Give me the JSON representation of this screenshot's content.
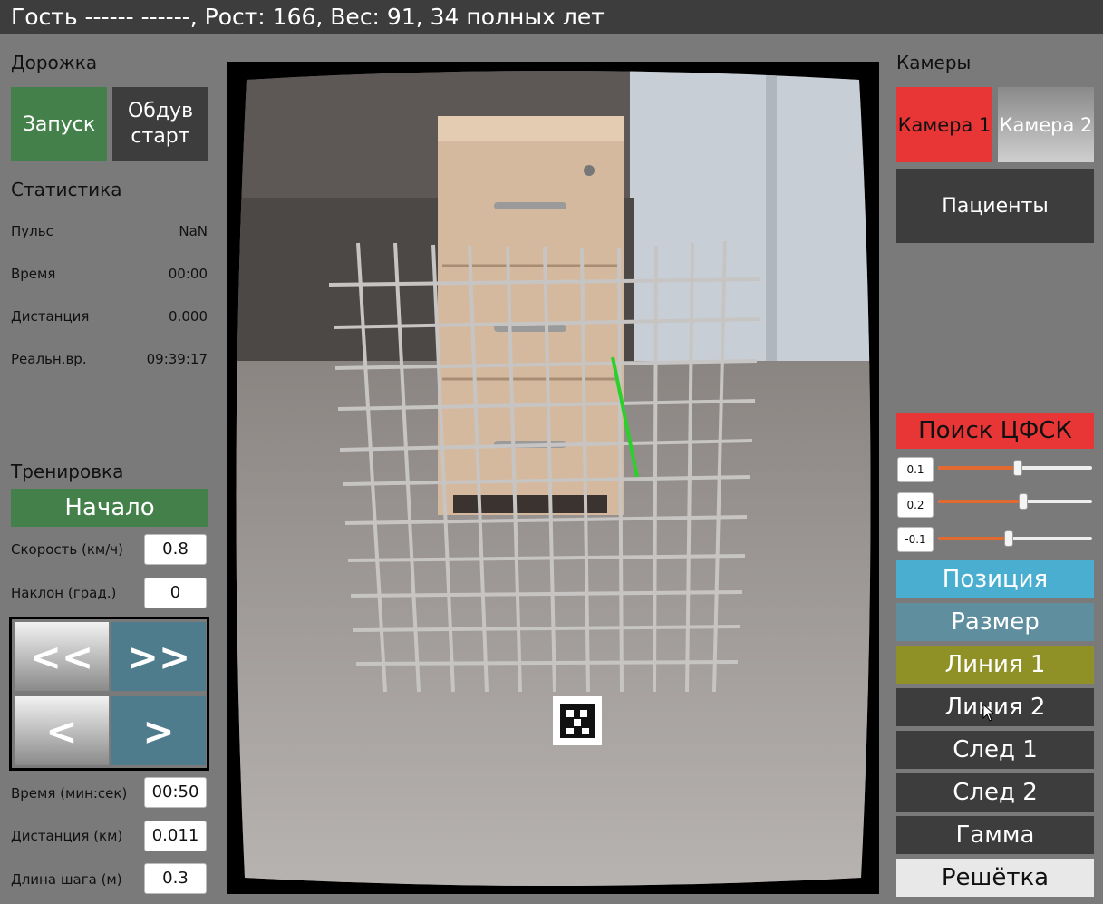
{
  "header": {
    "title": "Гость ------ ------, Рост: 166, Вес: 91, 34 полных лет"
  },
  "track": {
    "title": "Дорожка",
    "start_label": "Запуск",
    "blow_label_line1": "Обдув",
    "blow_label_line2": "старт"
  },
  "stats": {
    "title": "Статистика",
    "rows": [
      {
        "label": "Пульс",
        "value": "NaN"
      },
      {
        "label": "Время",
        "value": "00:00"
      },
      {
        "label": "Дистанция",
        "value": "0.000"
      },
      {
        "label": "Реальн.вр.",
        "value": "09:39:17"
      }
    ]
  },
  "training": {
    "title": "Тренировка",
    "begin_label": "Начало",
    "speed_label": "Скорость (км/ч)",
    "speed_value": "0.8",
    "incline_label": "Наклон (град.)",
    "incline_value": "0",
    "nav": {
      "fast_back": "<<",
      "fast_forward": ">>",
      "back": "<",
      "forward": ">"
    },
    "time_label": "Время (мин:сек)",
    "time_value": "00:50",
    "distance_label": "Дистанция (км)",
    "distance_value": "0.011",
    "step_label": "Длина шага (м)",
    "step_value": "0.3"
  },
  "cameras": {
    "title": "Камеры",
    "camera1_label": "Камера 1",
    "camera2_label": "Камера 2",
    "patients_label": "Пациенты"
  },
  "calibration": {
    "search_label": "Поиск ЦФСК",
    "sliders": [
      {
        "value": "0.1",
        "fraction": 0.52
      },
      {
        "value": "0.2",
        "fraction": 0.55
      },
      {
        "value": "-0.1",
        "fraction": 0.46
      }
    ],
    "buttons": [
      {
        "label": "Позиция",
        "color": "#49aed0"
      },
      {
        "label": "Размер",
        "color": "#5f8f9f"
      },
      {
        "label": "Линия 1",
        "color": "#8f9127"
      },
      {
        "label": "Линия 2",
        "color": "#3d3d3d"
      },
      {
        "label": "След 1",
        "color": "#3d3d3d"
      },
      {
        "label": "След 2",
        "color": "#3d3d3d"
      },
      {
        "label": "Гамма",
        "color": "#3d3d3d"
      },
      {
        "label": "Решётка",
        "color": "#e8e8e8"
      }
    ]
  },
  "colors": {
    "title_bar": "#3d3d3d",
    "green": "#43804a",
    "dark": "#3d3d3d",
    "camera_active": "#e83535",
    "search": "#e83535"
  }
}
